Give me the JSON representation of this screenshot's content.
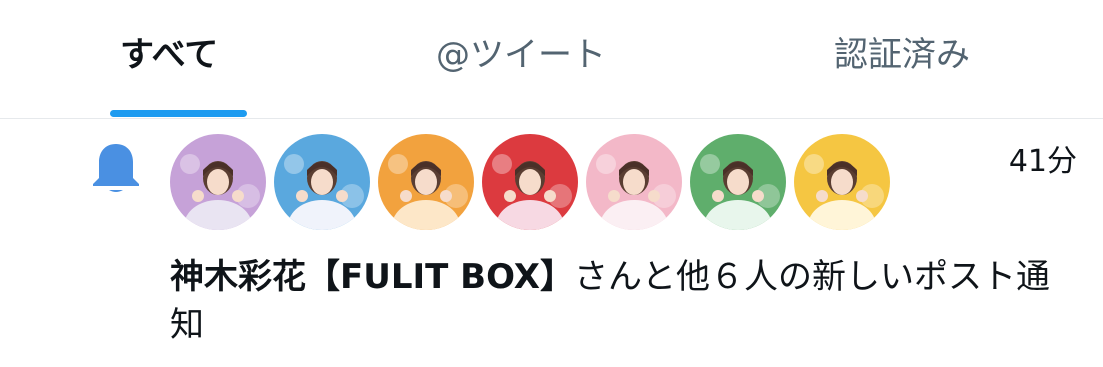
{
  "tabs": [
    {
      "label": "すべて",
      "selected": true
    },
    {
      "label": "@ツイート",
      "selected": false
    },
    {
      "label": "認証済み",
      "selected": false
    }
  ],
  "notification": {
    "icon": "bell-icon",
    "time": "41分",
    "name": "神木彩花【FULIT BOX】",
    "message": "さんと他６人の新しいポスト通知",
    "avatars": [
      {
        "name": "avatar-purple",
        "bg": "#c6a2d8",
        "outfit": "#e9e4f2"
      },
      {
        "name": "avatar-blue",
        "bg": "#5aa8de",
        "outfit": "#f0f3fb"
      },
      {
        "name": "avatar-orange",
        "bg": "#f2a23e",
        "outfit": "#fde7c8"
      },
      {
        "name": "avatar-red",
        "bg": "#dc3a3f",
        "outfit": "#f7d9e3"
      },
      {
        "name": "avatar-pink",
        "bg": "#f3b8c8",
        "outfit": "#fbeff3"
      },
      {
        "name": "avatar-green",
        "bg": "#5fae6c",
        "outfit": "#e8f6ec"
      },
      {
        "name": "avatar-yellow",
        "bg": "#f5c642",
        "outfit": "#fff5d8"
      }
    ]
  },
  "colors": {
    "accent": "#1d9bf0",
    "bell": "#4a90e2"
  }
}
